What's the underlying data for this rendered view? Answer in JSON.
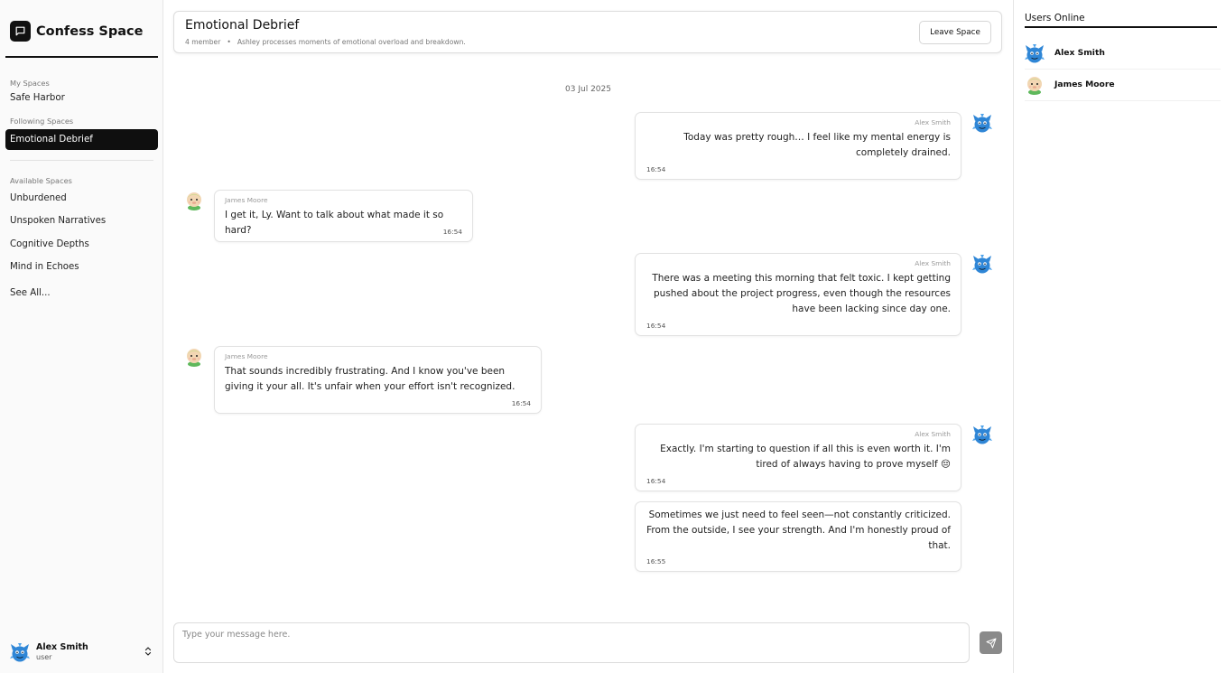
{
  "brand": {
    "title": "Confess Space"
  },
  "sidebar": {
    "my_spaces_label": "My Spaces",
    "my_spaces": [
      {
        "label": "Safe Harbor"
      }
    ],
    "following_label": "Following Spaces",
    "following": [
      {
        "label": "Emotional Debrief",
        "active": true
      }
    ],
    "available_label": "Available Spaces",
    "available": [
      {
        "label": "Unburdened"
      },
      {
        "label": "Unspoken Narratives"
      },
      {
        "label": "Cognitive Depths"
      },
      {
        "label": "Mind in Echoes"
      }
    ],
    "see_all": "See All..."
  },
  "current_user": {
    "name": "Alex Smith",
    "role": "user"
  },
  "header": {
    "title": "Emotional Debrief",
    "members": "4 member",
    "separator": "•",
    "description": "Ashley processes moments of emotional overload and breakdown.",
    "leave_label": "Leave Space"
  },
  "chat": {
    "date": "03 Jul 2025",
    "messages": [
      {
        "sender": "Alex Smith",
        "text": "Today was pretty rough… I feel like my mental energy is completely drained.",
        "time": "16:54",
        "direction": "out"
      },
      {
        "sender": "James Moore",
        "text": "I get it, Ly. Want to talk about what made it so hard?",
        "time": "16:54",
        "direction": "in"
      },
      {
        "sender": "Alex Smith",
        "text": "There was a meeting this morning that felt toxic. I kept getting pushed about the project progress, even though the resources have been lacking since day one.",
        "time": "16:54",
        "direction": "out"
      },
      {
        "sender": "James Moore",
        "text": "That sounds incredibly frustrating. And I know you've been giving it your all. It's unfair when your effort isn't recognized.",
        "time": "16:54",
        "direction": "in"
      },
      {
        "sender": "Alex Smith",
        "text": "Exactly. I'm starting to question if all this is even worth it. I'm tired of always having to prove myself 😔",
        "time": "16:54",
        "direction": "out"
      },
      {
        "sender": "",
        "text": "Sometimes we just need to feel seen—not constantly criticized. From the outside, I see your strength. And I'm honestly proud of that.",
        "time": "16:55",
        "direction": "out"
      }
    ]
  },
  "composer": {
    "placeholder": "Type your message here."
  },
  "online": {
    "title": "Users Online",
    "users": [
      {
        "name": "Alex Smith"
      },
      {
        "name": "James Moore"
      }
    ]
  },
  "colors": {
    "primary": "#0f0f0f",
    "avatar_blue": "#2f86d6",
    "avatar_green": "#5fb85c",
    "send_button": "#8a8a8a"
  },
  "icons": {
    "brand": "chat-bubble-icon",
    "user_switch": "chevron-up-down-icon",
    "send": "send-icon",
    "alex_avatar": "blue-monster-avatar",
    "james_avatar": "green-creature-avatar"
  }
}
